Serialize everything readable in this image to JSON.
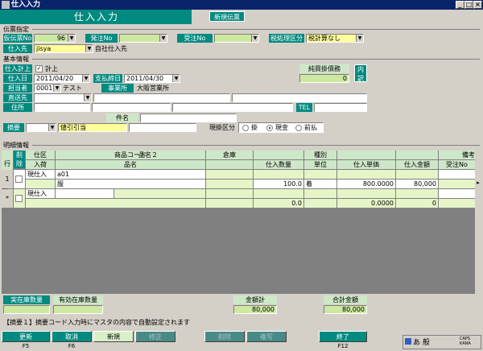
{
  "window": {
    "title": "仕入入力",
    "btn_min": "_",
    "btn_max": "□",
    "btn_close": "×"
  },
  "header": {
    "title": "仕入入力",
    "mode": "新規伝票"
  },
  "slip": {
    "section": "伝票指定",
    "slip_no_label": "仮伝票No",
    "slip_no": "96",
    "order_no_label": "発注No",
    "order_no": "",
    "receive_no_label": "受注No",
    "receive_no": "",
    "tax_label": "税処理区分",
    "tax": "税計算なし",
    "supplier_label": "仕入先",
    "supplier_code": "jisya",
    "supplier_name": "自社仕入先"
  },
  "basic": {
    "section": "基本情報",
    "post_label": "仕入計上",
    "post_text": "計上",
    "post_checked": "✓",
    "payable_label": "純買掛債務",
    "payable_value": "0",
    "payable_btn": "内訳",
    "date_label": "仕入日",
    "date": "2011/04/20",
    "close_label": "支払締日",
    "close_date": "2011/04/30",
    "staff_label": "担当者",
    "staff_code": "0001",
    "staff_name": "テスト",
    "office_label": "事業所",
    "office_name": "大阪営業所",
    "ship_label": "直送先",
    "ship_value": "",
    "address_label": "住所",
    "tel_label": "TEL",
    "subject_label": "件名",
    "subject_value": "",
    "memo_label": "摘要",
    "memo_value": "値引引当",
    "pay_label": "現掛区分",
    "pay_opt1": "掛",
    "pay_opt2": "現金",
    "pay_opt3": "前払"
  },
  "detail": {
    "section": "明細情報",
    "headers": {
      "row_no": "行No",
      "delete": "削除",
      "kind": "仕区",
      "arrival": "入荷",
      "product_code": "商品コード",
      "product_name2": "品名２",
      "product_name": "品名",
      "warehouse": "倉庫",
      "qty": "仕入数量",
      "category": "種別",
      "unit": "単位",
      "unit_price": "仕入単価",
      "amount": "仕入金額",
      "remarks": "備考",
      "order_no": "受注No"
    },
    "rows": [
      {
        "no": "1",
        "kind": "現仕入",
        "code": "a01",
        "name": "服",
        "qty": "100.0",
        "unit": "着",
        "price": "800.0000",
        "amount": "80,000"
      },
      {
        "no": "*",
        "kind": "現仕入",
        "code": "",
        "name": "",
        "qty": "0.0",
        "unit": "",
        "price": "0.0000",
        "amount": "0"
      }
    ]
  },
  "footer": {
    "stock_label": "実在庫数量",
    "stock_value": "",
    "avail_label": "有効在庫数量",
    "avail_value": "",
    "subtotal_label": "金額計",
    "subtotal_value": "80,000",
    "total_label": "合計金額",
    "total_value": "80,000",
    "hint": "【摘要１】摘要コード入力時にマスタの内容で自動設定されます"
  },
  "fkeys": [
    {
      "label": "更新",
      "key": "F5",
      "state": "on"
    },
    {
      "label": "取消",
      "key": "F6",
      "state": "on"
    },
    {
      "label": "新規",
      "key": "",
      "state": "new"
    },
    {
      "label": "修正",
      "key": "",
      "state": "dis"
    },
    {
      "label": "削除",
      "key": "",
      "state": "dis"
    },
    {
      "label": "複写",
      "key": "",
      "state": "dis"
    },
    {
      "label": "終了",
      "key": "F12",
      "state": "on"
    }
  ],
  "taskbar": {
    "ime": "あ 般",
    "caps": "CAPS KANA"
  },
  "colors": {
    "teal": "#008a80",
    "yellow": "#ffff99",
    "light_green": "#cfe7c9"
  }
}
